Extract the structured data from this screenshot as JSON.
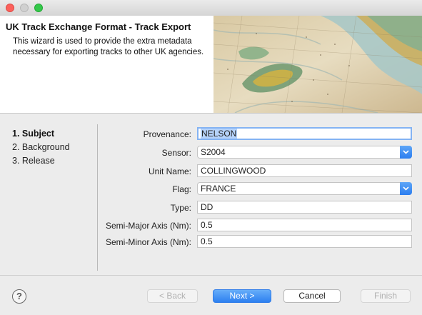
{
  "window": {
    "controls": [
      "close",
      "minimize",
      "maximize"
    ]
  },
  "header": {
    "title": "UK Track Exchange Format - Track Export",
    "description": "This wizard is used to provide the extra metadata necessary for exporting tracks to other UK agencies."
  },
  "steps": [
    "1. Subject",
    "2. Background",
    "3. Release"
  ],
  "active_step": "1. Subject",
  "form": {
    "provenance": {
      "label": "Provenance:",
      "value": "NELSON"
    },
    "sensor": {
      "label": "Sensor:",
      "value": "S2004"
    },
    "unit_name": {
      "label": "Unit Name:",
      "value": "COLLINGWOOD"
    },
    "flag": {
      "label": "Flag:",
      "value": "FRANCE"
    },
    "type": {
      "label": "Type:",
      "value": "DD"
    },
    "semi_major": {
      "label": "Semi-Major Axis (Nm):",
      "value": "0.5"
    },
    "semi_minor": {
      "label": "Semi-Minor Axis (Nm):",
      "value": "0.5"
    }
  },
  "buttons": {
    "back": "< Back",
    "next": "Next >",
    "cancel": "Cancel",
    "finish": "Finish",
    "help": "?"
  },
  "colors": {
    "accent": "#2d80f0",
    "focus": "#84b3f3",
    "selection": "#b6d3fb"
  }
}
